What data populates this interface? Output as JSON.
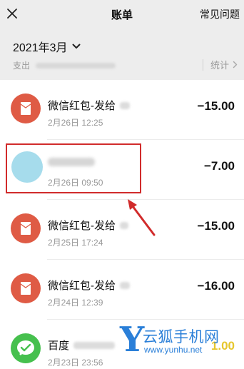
{
  "header": {
    "title": "账单",
    "faq_label": "常见问题"
  },
  "month_header": {
    "month": "2021年3月",
    "expense_label": "支出",
    "stats_label": "统计"
  },
  "transactions": [
    {
      "name": "微信红包-发给",
      "date": "2月26日 12:25",
      "amount": "−15.00",
      "icon": "red-packet-icon"
    },
    {
      "name": "",
      "date": "2月26日 09:50",
      "amount": "−7.00",
      "icon": "avatar"
    },
    {
      "name": "微信红包-发给",
      "date": "2月25日 17:24",
      "amount": "−15.00",
      "icon": "red-packet-icon"
    },
    {
      "name": "微信红包-发给",
      "date": "2月24日 12:39",
      "amount": "−16.00",
      "icon": "red-packet-icon"
    },
    {
      "name": "百度",
      "date": "2月23日 23:56",
      "amount": "1.00",
      "icon": "wechat-pay-icon"
    }
  ],
  "watermark": {
    "brand": "云狐手机网",
    "url": "www.yunhu.net"
  },
  "colors": {
    "red_packet": "#df5b45",
    "wechat_green": "#46c04e",
    "annotation_red": "#d12b2b",
    "watermark_blue": "#2a7fd8"
  }
}
